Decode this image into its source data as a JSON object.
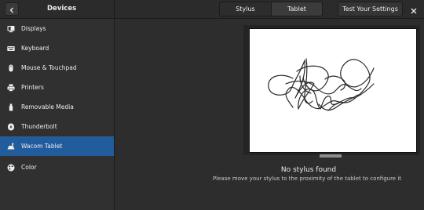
{
  "header": {
    "title": "Devices",
    "back_icon": "chevron-left-icon",
    "tabs": [
      {
        "label": "Stylus",
        "selected": false
      },
      {
        "label": "Tablet",
        "selected": true
      }
    ],
    "test_button_label": "Test Your Settings",
    "close_icon": "close-icon"
  },
  "sidebar": {
    "items": [
      {
        "label": "Displays",
        "icon": "display-icon",
        "active": false
      },
      {
        "label": "Keyboard",
        "icon": "keyboard-icon",
        "active": false
      },
      {
        "label": "Mouse & Touchpad",
        "icon": "mouse-icon",
        "active": false
      },
      {
        "label": "Printers",
        "icon": "printer-icon",
        "active": false
      },
      {
        "label": "Removable Media",
        "icon": "usb-drive-icon",
        "active": false
      },
      {
        "label": "Thunderbolt",
        "icon": "thunderbolt-icon",
        "active": false
      },
      {
        "label": "Wacom Tablet",
        "icon": "tablet-icon",
        "active": true
      },
      {
        "label": "Color",
        "icon": "color-palette-icon",
        "active": false
      }
    ]
  },
  "main": {
    "status_title": "No stylus found",
    "status_hint": "Please move your stylus to the proximity of the tablet to configure it"
  },
  "colors": {
    "accent": "#215d9c",
    "background": "#2d2d2d",
    "text": "#eeeeec"
  }
}
